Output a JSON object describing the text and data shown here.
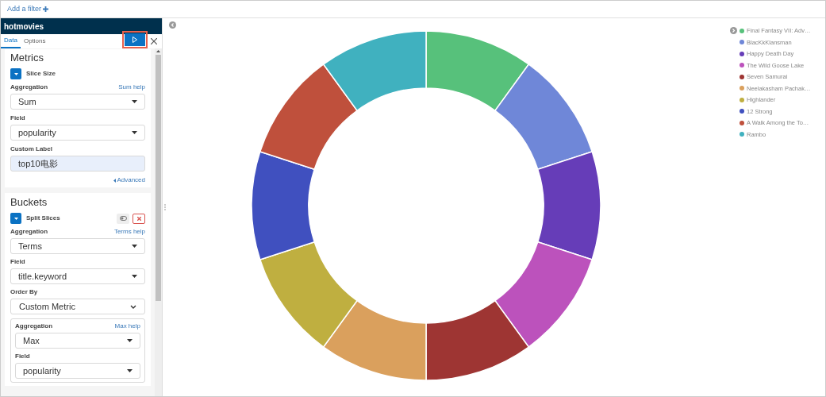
{
  "filter_bar": {
    "add_filter": "Add a filter"
  },
  "panel": {
    "title": "hotmovies",
    "tabs": [
      {
        "label": "Data",
        "selected": true
      },
      {
        "label": "Options",
        "selected": false
      }
    ],
    "metrics": {
      "heading": "Metrics",
      "agg_title": "Slice Size",
      "fields": [
        {
          "label": "Aggregation",
          "help": "Sum help",
          "value": "Sum",
          "kind": "select"
        },
        {
          "label": "Field",
          "value": "popularity",
          "kind": "select"
        },
        {
          "label": "Custom Label",
          "value": "top10电影",
          "kind": "input"
        }
      ],
      "advanced": "Advanced"
    },
    "buckets": {
      "heading": "Buckets",
      "agg_title": "Split Slices",
      "fields": [
        {
          "label": "Aggregation",
          "help": "Terms help",
          "value": "Terms",
          "kind": "select"
        },
        {
          "label": "Field",
          "value": "title.keyword",
          "kind": "select"
        },
        {
          "label": "Order By",
          "value": "Custom Metric",
          "kind": "native"
        }
      ],
      "order_metric": [
        {
          "label": "Aggregation",
          "help": "Max help",
          "value": "Max",
          "kind": "select"
        },
        {
          "label": "Field",
          "value": "popularity",
          "kind": "select"
        }
      ]
    }
  },
  "legend": [
    {
      "label": "Final Fantasy VII: Adv…",
      "color": "#57c17b"
    },
    {
      "label": "BlacKkKlansman",
      "color": "#6f87d8"
    },
    {
      "label": "Happy Death Day",
      "color": "#663db8"
    },
    {
      "label": "The Wild Goose Lake",
      "color": "#bc52bc"
    },
    {
      "label": "Seven Samurai",
      "color": "#9e3533"
    },
    {
      "label": "Neelakasham Pachak…",
      "color": "#daa05d"
    },
    {
      "label": "Highlander",
      "color": "#bfaf40"
    },
    {
      "label": "12 Strong",
      "color": "#4050bf"
    },
    {
      "label": "A Walk Among the To…",
      "color": "#bf503c"
    },
    {
      "label": "Rambo",
      "color": "#40b1bf"
    }
  ]
}
